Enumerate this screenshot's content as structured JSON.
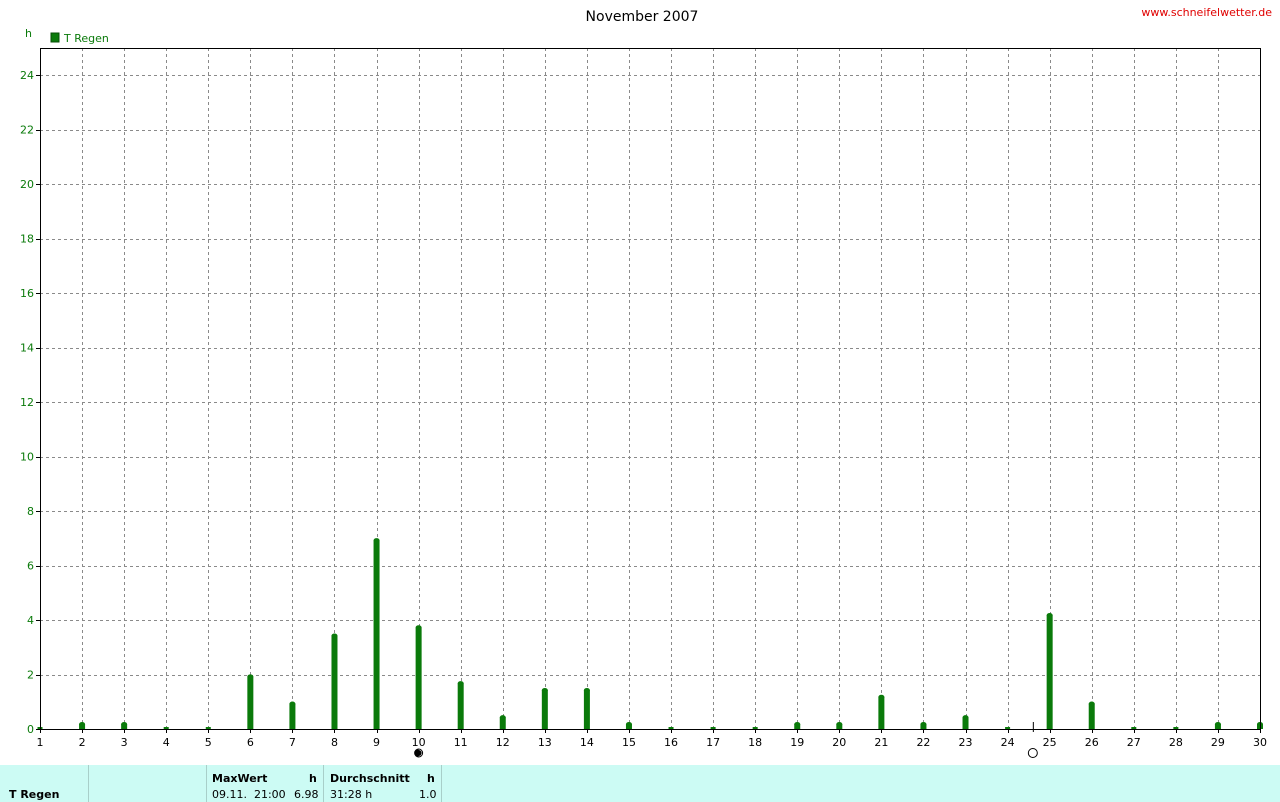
{
  "watermark": "www.schneifelwetter.de",
  "chart_data": {
    "type": "bar",
    "title": "November 2007",
    "yunit": "h",
    "series": [
      {
        "name": "T Regen",
        "color": "#0a7a0a",
        "x": [
          1,
          2,
          3,
          4,
          5,
          6,
          7,
          8,
          9,
          10,
          11,
          12,
          13,
          14,
          15,
          16,
          17,
          18,
          19,
          20,
          21,
          22,
          23,
          24,
          25,
          26,
          27,
          28,
          29,
          30
        ],
        "values": [
          0,
          0.25,
          0.25,
          0,
          0,
          2.0,
          1.0,
          3.5,
          7.0,
          3.8,
          1.75,
          0.5,
          1.5,
          1.5,
          0.25,
          0,
          0,
          0,
          0.25,
          0.25,
          1.25,
          0.25,
          0.5,
          0,
          4.25,
          1.0,
          0,
          0,
          0.25,
          0.25
        ]
      }
    ],
    "x_ticks": [
      "1",
      "2",
      "3",
      "4",
      "5",
      "6",
      "7",
      "8",
      "9",
      "10",
      "11",
      "12",
      "13",
      "14",
      "15",
      "16",
      "17",
      "18",
      "19",
      "20",
      "21",
      "22",
      "23",
      "24",
      "25",
      "26",
      "27",
      "28",
      "29",
      "30"
    ],
    "y_ticks": [
      "0",
      "2",
      "4",
      "6",
      "8",
      "10",
      "12",
      "14",
      "16",
      "18",
      "20",
      "22",
      "24"
    ],
    "xlim": [
      1,
      30
    ],
    "ylim": [
      0,
      25
    ],
    "grid": true,
    "legend": "top-left",
    "moon_phases": [
      {
        "x": 10,
        "phase": "new-moon"
      },
      {
        "x": 24.6,
        "phase": "full-moon"
      }
    ]
  },
  "footer": {
    "series_label": "T Regen",
    "max_header": "MaxWert",
    "max_unit": "h",
    "max_time": "09.11.  21:00",
    "max_value": "6.98",
    "avg_header": "Durchschnitt",
    "avg_unit": "h",
    "avg_total": "31:28 h",
    "avg_value": "1.0"
  }
}
